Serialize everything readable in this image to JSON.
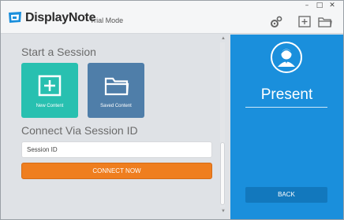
{
  "app": {
    "logo_text": "DisplayNote",
    "mode": "Trial Mode"
  },
  "window_controls": {
    "minimize": "–",
    "maximize": "□",
    "close": "✕"
  },
  "toolbar": {
    "icons": [
      "gear-icon",
      "add-icon",
      "folder-icon"
    ]
  },
  "start_session": {
    "title": "Start a Session",
    "tiles": [
      {
        "label": "New Content",
        "icon": "add-icon",
        "color": "#28c0b0"
      },
      {
        "label": "Saved Content",
        "icon": "folder-icon",
        "color": "#4f7ea9"
      }
    ]
  },
  "connect": {
    "title": "Connect Via Session ID",
    "input_value": "Session ID",
    "button_label": "CONNECT NOW",
    "button_color": "#ef7e1f"
  },
  "present_panel": {
    "title": "Present",
    "back_label": "BACK",
    "bg_color": "#1a8fdc",
    "icon": "user-icon"
  }
}
